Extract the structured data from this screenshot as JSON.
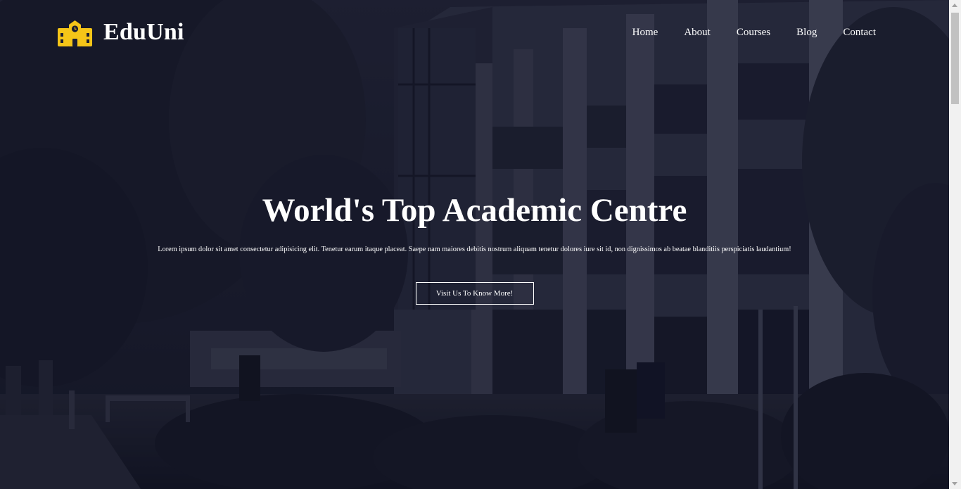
{
  "brand": {
    "name": "EduUni",
    "logo_icon": "school-building-icon",
    "logo_color": "#f5c518"
  },
  "nav": {
    "items": [
      {
        "label": "Home"
      },
      {
        "label": "About"
      },
      {
        "label": "Courses"
      },
      {
        "label": "Blog"
      },
      {
        "label": "Contact"
      }
    ]
  },
  "hero": {
    "title": "World's Top Academic Centre",
    "text": "Lorem ipsum dolor sit amet consectetur adipisicing elit. Tenetur earum itaque placeat. Saepe nam maiores debitis nostrum aliquam tenetur dolores iure sit id, non dignissimos ab beatae blanditiis perspiciatis laudantium!",
    "button_label": "Visit Us To Know More!",
    "background": "campus-building-photo",
    "overlay_color": "#0e0f20"
  }
}
